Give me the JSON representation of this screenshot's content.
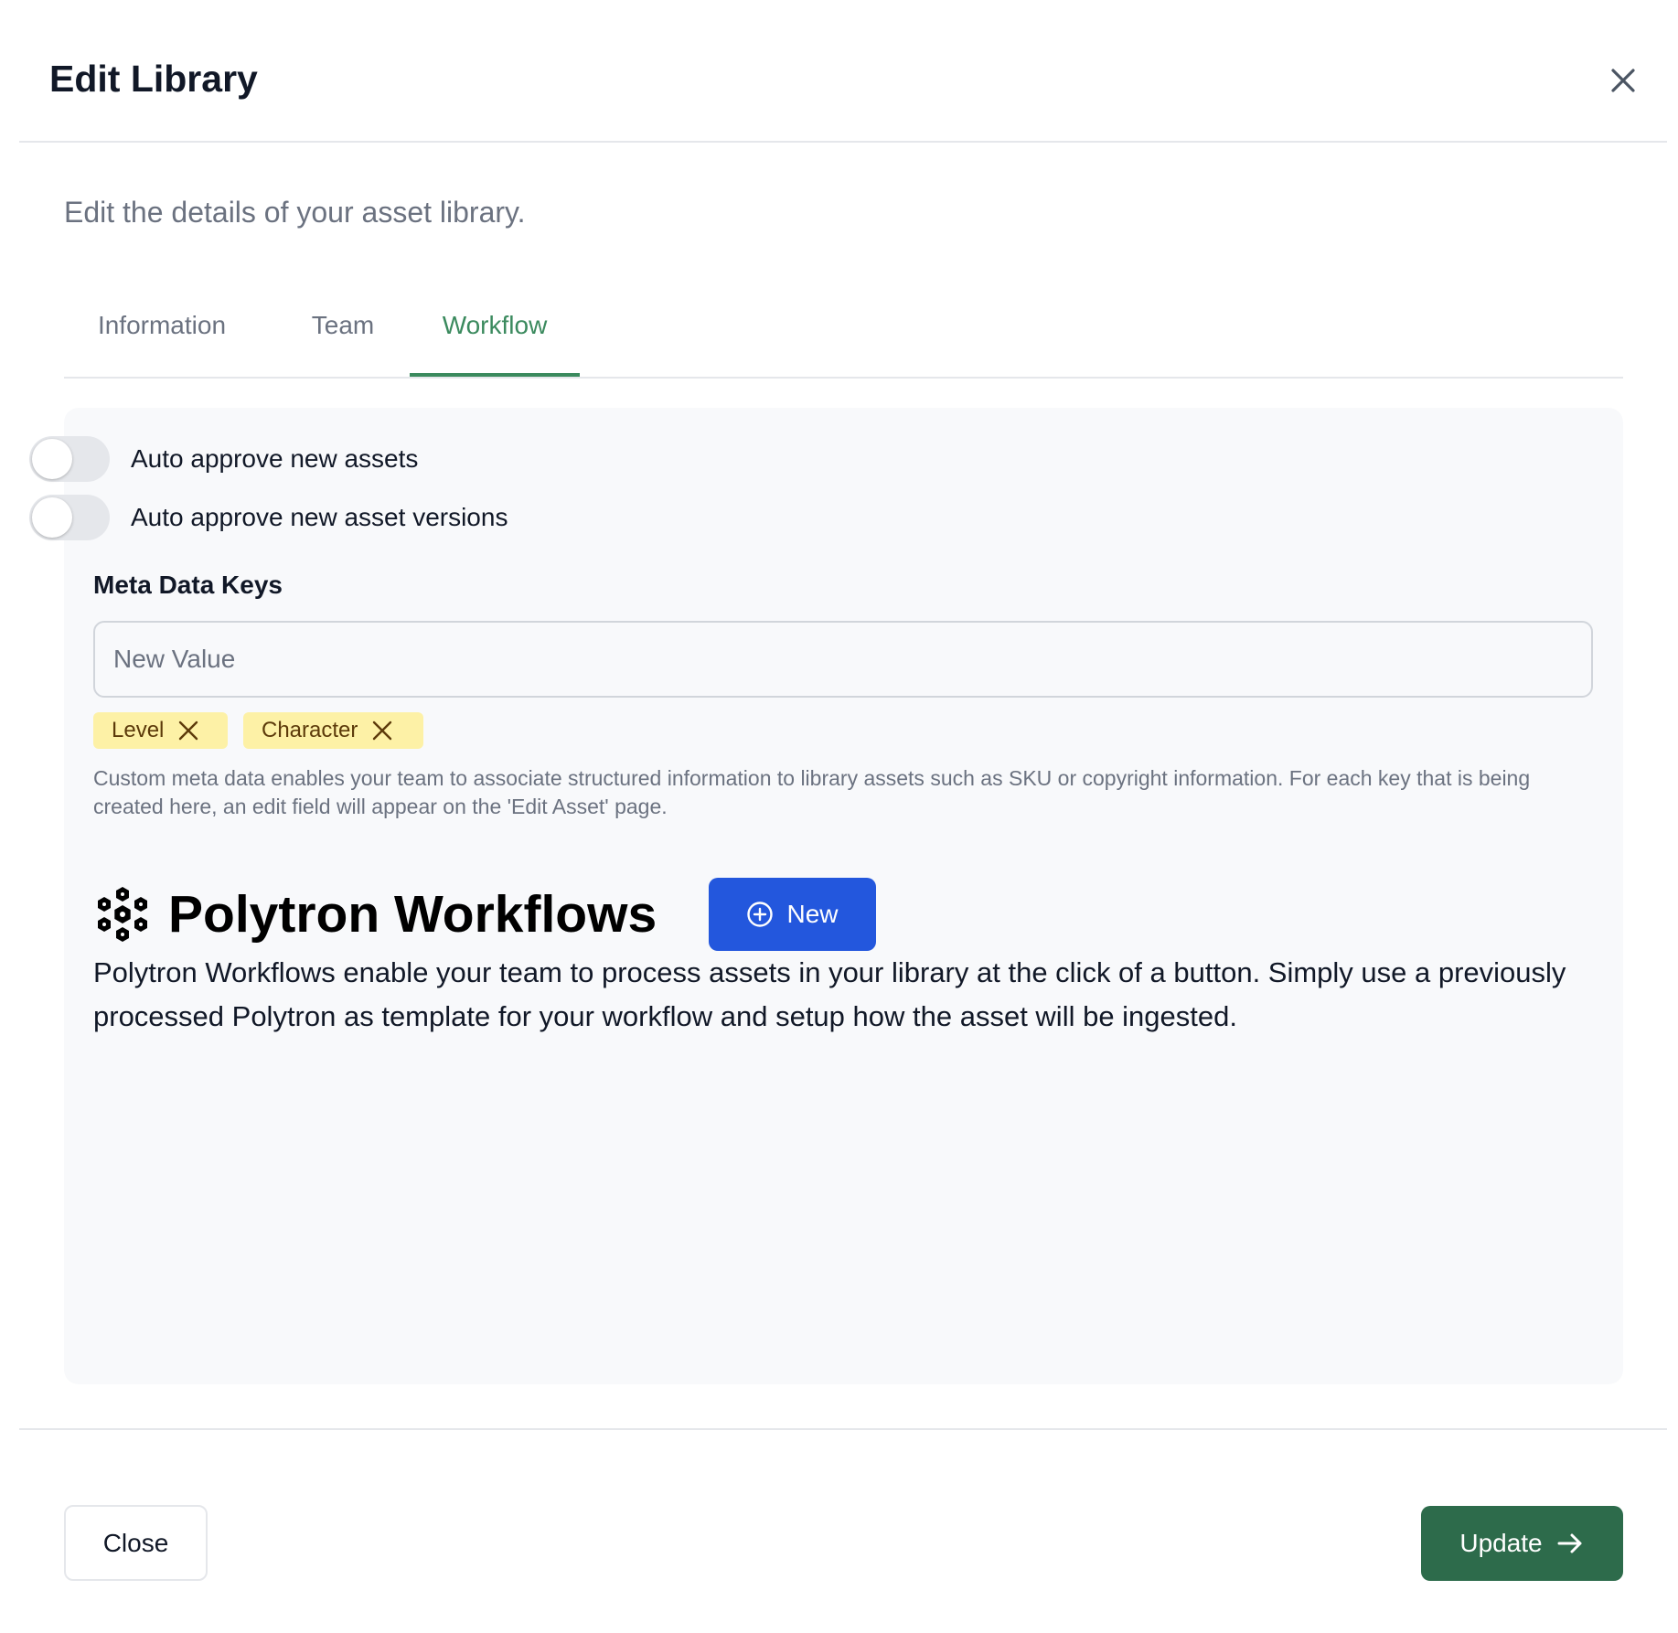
{
  "dialog": {
    "title": "Edit Library",
    "subtitle": "Edit the details of your asset library."
  },
  "tabs": [
    {
      "label": "Information",
      "active": false
    },
    {
      "label": "Team",
      "active": false
    },
    {
      "label": "Workflow",
      "active": true
    }
  ],
  "workflow": {
    "toggles": [
      {
        "label": "Auto approve new assets",
        "on": false
      },
      {
        "label": "Auto approve new asset versions",
        "on": false
      }
    ],
    "meta_label": "Meta Data Keys",
    "meta_input": {
      "value": "",
      "placeholder": "New Value"
    },
    "tags": [
      "Level",
      "Character"
    ],
    "meta_helper": "Custom meta data enables your team to associate structured information to library assets such as SKU or copyright information. For each key that is being created here, an edit field will appear on the 'Edit Asset' page.",
    "polytron": {
      "icon": "hexagon-cluster-icon",
      "title": "Polytron Workflows",
      "new_label": "New",
      "description": "Polytron Workflows enable your team to process assets in your library at the click of a button. Simply use a previously processed Polytron as template for your workflow and setup how the asset will be ingested."
    }
  },
  "footer": {
    "close_label": "Close",
    "update_label": "Update"
  },
  "colors": {
    "accent_green": "#3b8a5e",
    "update_button": "#2d6b4b",
    "new_button": "#2357dd",
    "tag_bg": "#fdf1a6",
    "panel_bg": "#f8f9fb"
  }
}
